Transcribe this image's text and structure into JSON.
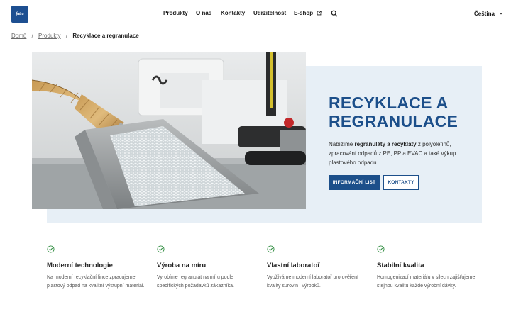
{
  "header": {
    "logo_text": "fatra",
    "nav": [
      {
        "label": "Produkty"
      },
      {
        "label": "O nás"
      },
      {
        "label": "Kontakty"
      },
      {
        "label": "Udržitelnost"
      },
      {
        "label": "E-shop"
      }
    ],
    "language": "Čeština"
  },
  "breadcrumb": {
    "items": [
      "Domů",
      "Produkty"
    ],
    "current": "Recyklace a regranulace"
  },
  "hero": {
    "title_line1": "RECYKLACE A",
    "title_line2": "REGRANULACE",
    "text_part1": "Nabízíme ",
    "text_bold1": "regranuláty a recykláty",
    "text_part2": " z polyolefinů, zpracování odpadů z PE, PP a EVAC a také výkup plastového odpadu.",
    "primary_button": "INFORMAČNÍ LIST",
    "secondary_button": "KONTAKTY"
  },
  "features": [
    {
      "title": "Moderní technologie",
      "desc": "Na moderní recyklační lince zpracujeme plastový odpad na kvalitní výstupní materiál."
    },
    {
      "title": "Výroba na míru",
      "desc": "Vyrobíme regranulát na míru podle specifických požadavků zákazníka."
    },
    {
      "title": "Vlastní laboratoř",
      "desc": "Využíváme moderní laboratoř pro ověření kvality surovin i výrobků."
    },
    {
      "title": "Stabilní kvalita",
      "desc": "Homogenizací materiálu v silech zajišťujeme stejnou kvalitu každé výrobní dávky."
    }
  ],
  "colors": {
    "brand": "#1c4f8a",
    "hero_bg": "#e7eff6",
    "check": "#2e8b3e"
  },
  "icons": {
    "search": "search-icon",
    "external": "external-link-icon",
    "chevron": "chevron-down-icon",
    "check": "check-circle-icon"
  }
}
